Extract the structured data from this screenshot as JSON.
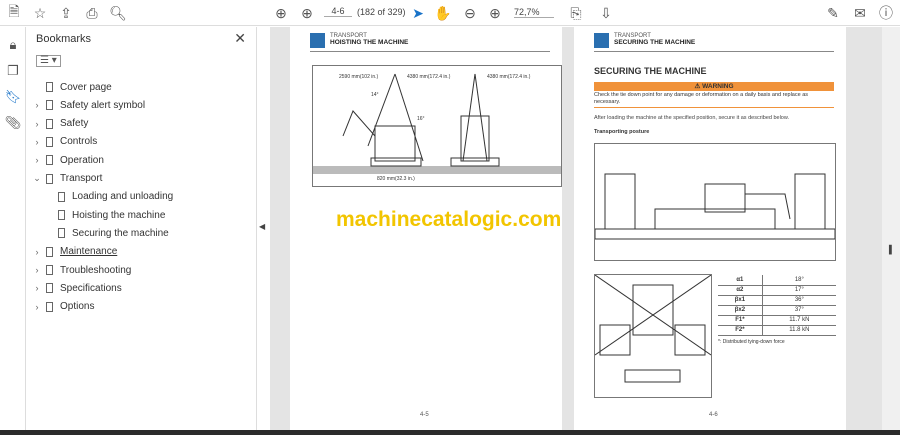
{
  "toolbar": {
    "page_input": "4-6",
    "page_count": "(182 of 329)",
    "zoom": "72,7%"
  },
  "bookmarks": {
    "title": "Bookmarks",
    "items": [
      {
        "label": "Cover page",
        "expand": false,
        "level": 0
      },
      {
        "label": "Safety alert symbol",
        "expand": true,
        "level": 0
      },
      {
        "label": "Safety",
        "expand": true,
        "level": 0
      },
      {
        "label": "Controls",
        "expand": true,
        "level": 0
      },
      {
        "label": "Operation",
        "expand": true,
        "level": 0
      },
      {
        "label": "Transport",
        "expand": true,
        "open": true,
        "level": 0
      },
      {
        "label": "Loading and unloading",
        "level": 1
      },
      {
        "label": "Hoisting the machine",
        "level": 1
      },
      {
        "label": "Securing the machine",
        "level": 1
      },
      {
        "label": "Maintenance",
        "expand": true,
        "level": 0
      },
      {
        "label": "Troubleshooting",
        "expand": true,
        "level": 0
      },
      {
        "label": "Specifications",
        "expand": true,
        "level": 0
      },
      {
        "label": "Options",
        "expand": true,
        "level": 0
      }
    ]
  },
  "left_page": {
    "section": "TRANSPORT",
    "title": "HOISTING THE MACHINE",
    "dim1": "2590 mm(102 in.)",
    "dim2": "4380 mm(172.4 in.)",
    "dim3": "4380 mm(172.4 in.)",
    "dim4": "820 mm(32.3 in.)",
    "angle1": "14°",
    "angle2": "16°",
    "page_number": "4-5"
  },
  "right_page": {
    "section": "TRANSPORT",
    "title": "SECURING THE MACHINE",
    "heading": "SECURING THE MACHINE",
    "warning_label": "WARNING",
    "warning_text": "Check the tie down point for any damage or deformation on a daily basis and replace as necessary.",
    "body": "After loading the machine at the specified position, secure it as described below.",
    "subheading": "Transporting posture",
    "table": [
      [
        "α1",
        "18°"
      ],
      [
        "α2",
        "17°"
      ],
      [
        "βx1",
        "36°"
      ],
      [
        "βx2",
        "37°"
      ],
      [
        "F1*",
        "11.7 kN"
      ],
      [
        "F2*",
        "11.8 kN"
      ]
    ],
    "footnote": "*: Distributed tying-down force",
    "page_number": "4-6"
  },
  "watermark": "machinecatalogic.com",
  "colors": {
    "warning": "#f0923a",
    "watermark": "#f2c500",
    "icon_blue": "#1a73c8"
  }
}
